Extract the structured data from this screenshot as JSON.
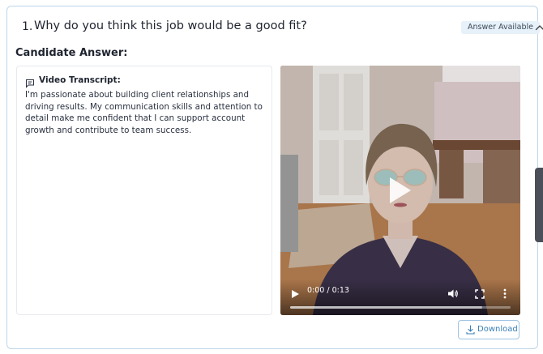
{
  "question": {
    "number": "1.",
    "text": "Why do you think this job would be a good fit?",
    "badge": "Answer Available",
    "collapse_icon": "chevron-up-icon"
  },
  "answer": {
    "section_title": "Candidate Answer:",
    "transcript_label": "Video Transcript:",
    "transcript_icon": "chat-bubble-icon",
    "transcript_text": "I'm passionate about building client relationships and driving results. My communication skills and attention to detail make me confident that I can support account growth and contribute to team success."
  },
  "video": {
    "time_display": "0:00 / 0:13",
    "progress": 0.0,
    "buffered_fraction": 0.87,
    "controls": [
      "play-icon",
      "volume-icon",
      "fullscreen-icon",
      "more-vert-icon"
    ]
  },
  "download": {
    "label": "Download",
    "icon": "download-icon"
  },
  "colors": {
    "accent": "#3a7fb6",
    "card_border": "#bcd6ea",
    "badge_bg": "#e7f1f9"
  }
}
